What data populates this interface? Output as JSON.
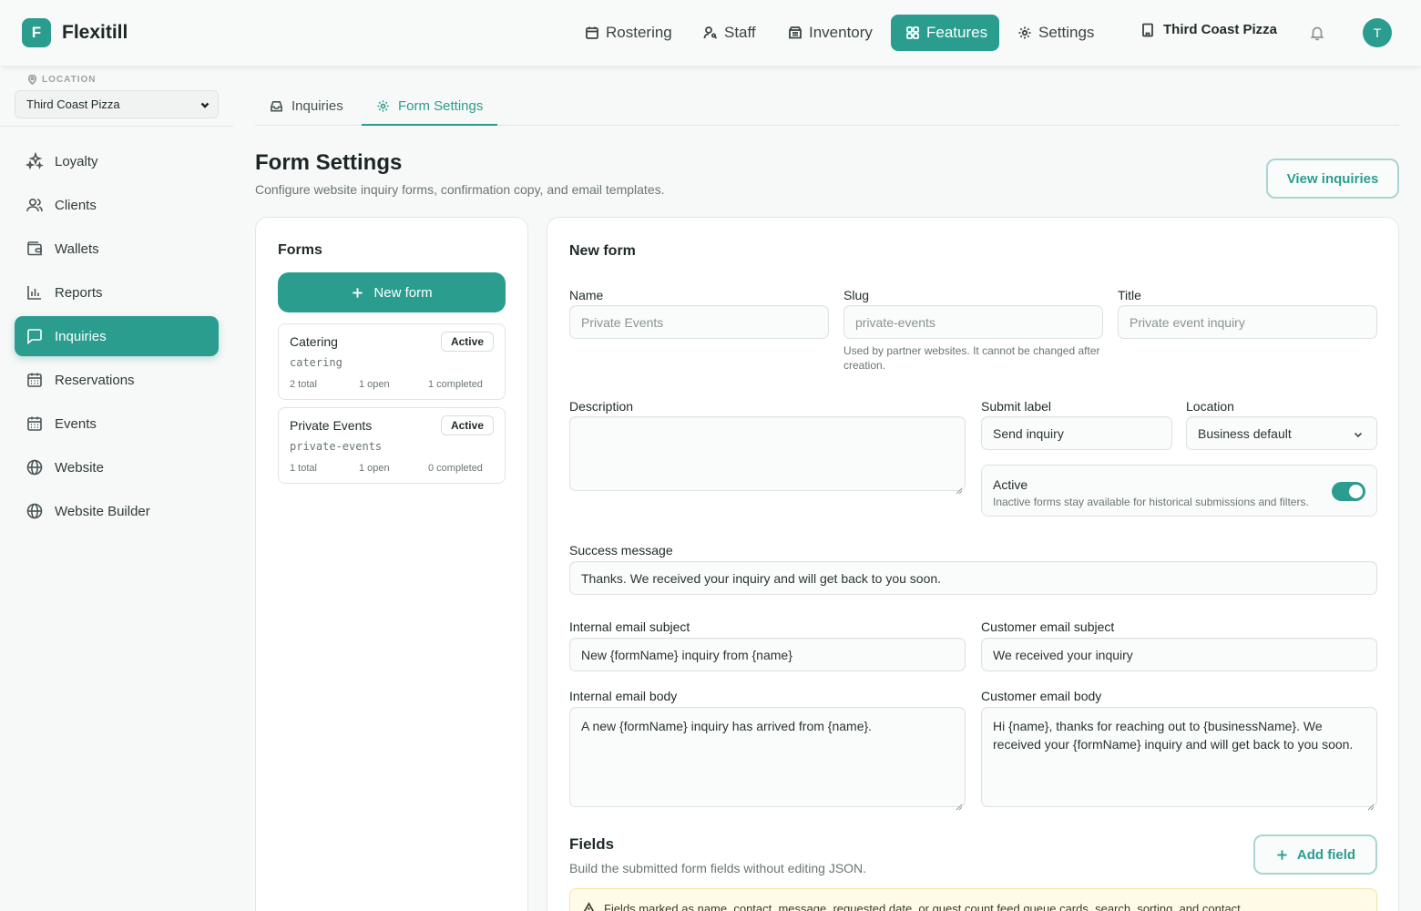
{
  "app": {
    "logo_letter": "F",
    "name": "Flexitill"
  },
  "nav": {
    "items": [
      {
        "label": "Rostering",
        "icon": "calendar-icon"
      },
      {
        "label": "Staff",
        "icon": "user-key-icon"
      },
      {
        "label": "Inventory",
        "icon": "archive-icon"
      },
      {
        "label": "Features",
        "icon": "grid-icon"
      },
      {
        "label": "Settings",
        "icon": "gear-icon"
      }
    ],
    "active": "Features",
    "business": "Third Coast Pizza",
    "avatar_letter": "T"
  },
  "sidebar": {
    "location_label": "LOCATION",
    "location_value": "Third Coast Pizza",
    "items": [
      {
        "label": "Loyalty",
        "icon": "sparkles-icon"
      },
      {
        "label": "Clients",
        "icon": "users-icon"
      },
      {
        "label": "Wallets",
        "icon": "wallet-icon"
      },
      {
        "label": "Reports",
        "icon": "bar-chart-icon"
      },
      {
        "label": "Inquiries",
        "icon": "message-square-icon"
      },
      {
        "label": "Reservations",
        "icon": "calendar-icon"
      },
      {
        "label": "Events",
        "icon": "calendar-icon"
      },
      {
        "label": "Website",
        "icon": "globe-icon"
      },
      {
        "label": "Website Builder",
        "icon": "globe-icon"
      }
    ],
    "active": "Inquiries"
  },
  "tabs": [
    {
      "label": "Inquiries",
      "icon": "inbox-icon"
    },
    {
      "label": "Form Settings",
      "icon": "gear-icon"
    }
  ],
  "page": {
    "title": "Form Settings",
    "subtitle": "Configure website inquiry forms, confirmation copy, and email templates.",
    "view_inquiries": "View inquiries"
  },
  "forms_panel": {
    "title": "Forms",
    "new_form": "New form",
    "forms": [
      {
        "name": "Catering",
        "status": "Active",
        "slug": "catering",
        "total": "2 total",
        "open": "1 open",
        "completed": "1 completed"
      },
      {
        "name": "Private Events",
        "status": "Active",
        "slug": "private-events",
        "total": "1 total",
        "open": "1 open",
        "completed": "0 completed"
      }
    ]
  },
  "editor": {
    "title": "New form",
    "name_label": "Name",
    "name_placeholder": "Private Events",
    "slug_label": "Slug",
    "slug_placeholder": "private-events",
    "slug_hint": "Used by partner websites. It cannot be changed after creation.",
    "title_label": "Title",
    "title_placeholder": "Private event inquiry",
    "description_label": "Description",
    "description_value": "",
    "submit_label_label": "Submit label",
    "submit_label_value": "Send inquiry",
    "location_label": "Location",
    "location_value": "Business default",
    "active_title": "Active",
    "active_desc": "Inactive forms stay available for historical submissions and filters.",
    "active_on": true,
    "success_label": "Success message",
    "success_value": "Thanks. We received your inquiry and will get back to you soon.",
    "internal_subject_label": "Internal email subject",
    "internal_subject_value": "New {formName} inquiry from {name}",
    "customer_subject_label": "Customer email subject",
    "customer_subject_value": "We received your inquiry",
    "internal_body_label": "Internal email body",
    "internal_body_value": "A new {formName} inquiry has arrived from {name}.",
    "customer_body_label": "Customer email body",
    "customer_body_value": "Hi {name}, thanks for reaching out to {businessName}. We received your {formName} inquiry and will get back to you soon.",
    "fields_title": "Fields",
    "fields_sub": "Build the submitted form fields without editing JSON.",
    "add_field": "Add field",
    "warning": "Fields marked as name, contact, message, requested date, or guest count feed queue cards, search, sorting, and contact"
  },
  "colors": {
    "accent": "#2a9d8f",
    "warning_bg": "#fffbe8"
  }
}
